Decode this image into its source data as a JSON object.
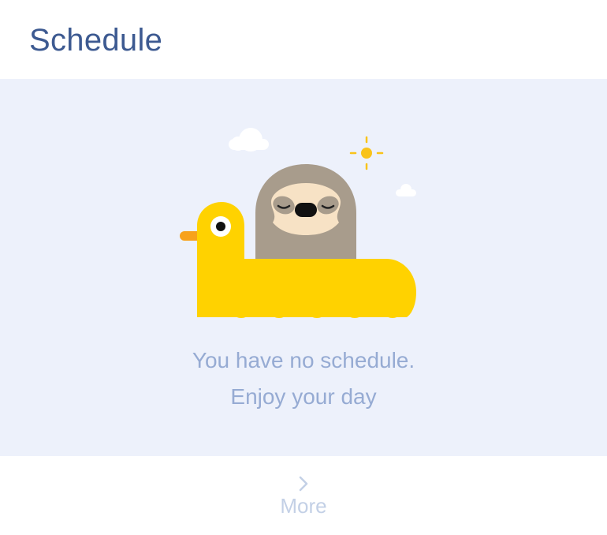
{
  "header": {
    "title": "Schedule"
  },
  "empty_state": {
    "illustration": "sloth-in-duck-float",
    "line1": "You have no schedule.",
    "line2": "Enjoy your day"
  },
  "footer": {
    "more_label": "More",
    "more_icon": "chevron-right-icon"
  },
  "colors": {
    "title": "#3d5a91",
    "panel_background": "#edf1fb",
    "message_text": "#96abd3",
    "more_text": "#c3d0e6",
    "duck_yellow": "#ffd200",
    "duck_beak": "#f7a21b",
    "sloth_fur": "#a89c8c",
    "sloth_face": "#f7e2c5",
    "sun": "#f9c31a"
  }
}
